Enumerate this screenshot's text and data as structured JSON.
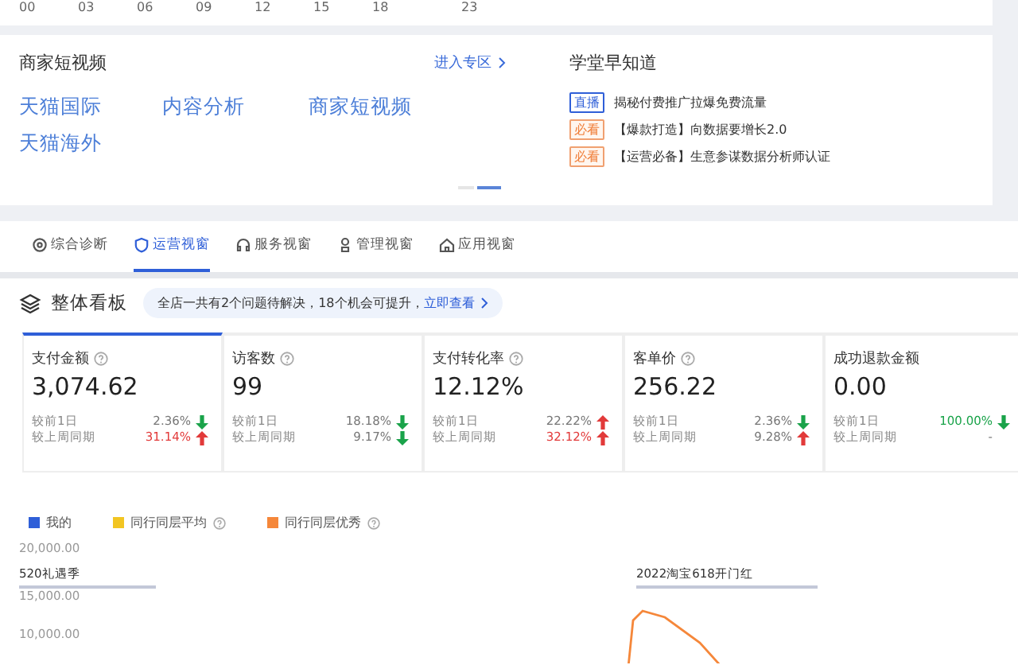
{
  "top_chart": {
    "x_labels": [
      "00",
      "03",
      "06",
      "09",
      "12",
      "15",
      "18",
      "23"
    ]
  },
  "short_video": {
    "title": "商家短视频",
    "link": "进入专区",
    "links": [
      "天猫国际",
      "内容分析",
      "商家短视频",
      "天猫海外"
    ],
    "pager": [
      {
        "selected": false
      },
      {
        "selected": true
      }
    ]
  },
  "academy": {
    "title": "学堂早知道",
    "items": [
      {
        "kind": "live",
        "tag": "直播",
        "text": "揭秘付费推广拉爆免费流量"
      },
      {
        "kind": "must",
        "tag": "必看",
        "text": "【爆款打造】向数据要增长2.0"
      },
      {
        "kind": "must",
        "tag": "必看",
        "text": "【运营必备】生意参谋数据分析师认证"
      }
    ]
  },
  "tabs": [
    {
      "label": "综合诊断",
      "selected": false
    },
    {
      "label": "运营视窗",
      "selected": true
    },
    {
      "label": "服务视窗",
      "selected": false
    },
    {
      "label": "管理视窗",
      "selected": false
    },
    {
      "label": "应用视窗",
      "selected": false
    }
  ],
  "board": {
    "title": "整体看板",
    "notice": "全店一共有2个问题待解决，18个机会可提升，",
    "notice_link": "立即查看"
  },
  "metrics": [
    {
      "name": "支付金额",
      "help": true,
      "value": "3,074.62",
      "selected": true,
      "rows": [
        {
          "label": "较前1日",
          "value": "2.36%",
          "kind": "down",
          "emphasized": false
        },
        {
          "label": "较上周同期",
          "value": "31.14%",
          "kind": "up",
          "emphasized": true
        }
      ]
    },
    {
      "name": "访客数",
      "help": true,
      "value": "99",
      "selected": false,
      "rows": [
        {
          "label": "较前1日",
          "value": "18.18%",
          "kind": "down",
          "emphasized": false
        },
        {
          "label": "较上周同期",
          "value": "9.17%",
          "kind": "down",
          "emphasized": false
        }
      ]
    },
    {
      "name": "支付转化率",
      "help": true,
      "value": "12.12%",
      "selected": false,
      "rows": [
        {
          "label": "较前1日",
          "value": "22.22%",
          "kind": "up",
          "emphasized": false
        },
        {
          "label": "较上周同期",
          "value": "32.12%",
          "kind": "up",
          "emphasized": true
        }
      ]
    },
    {
      "name": "客单价",
      "help": true,
      "value": "256.22",
      "selected": false,
      "rows": [
        {
          "label": "较前1日",
          "value": "2.36%",
          "kind": "down",
          "emphasized": false
        },
        {
          "label": "较上周同期",
          "value": "9.28%",
          "kind": "up",
          "emphasized": false
        }
      ]
    },
    {
      "name": "成功退款金额",
      "help": false,
      "value": "0.00",
      "selected": false,
      "rows": [
        {
          "label": "较前1日",
          "value": "100.00%",
          "kind": "down",
          "emphasized": true
        },
        {
          "label": "较上周同期",
          "value": "-",
          "kind": "none",
          "emphasized": false
        }
      ]
    }
  ],
  "trend_chart": {
    "legend": [
      {
        "label": "我的",
        "color": "#2f5fd8",
        "help": false
      },
      {
        "label": "同行同层平均",
        "color": "#f2c522",
        "help": true
      },
      {
        "label": "同行同层优秀",
        "color": "#f5873a",
        "help": true
      }
    ],
    "y_labels": [
      "20,000.00",
      "15,000.00",
      "10,000.00"
    ],
    "events": [
      "520礼遇季",
      "2022淘宝618开门红"
    ]
  }
}
